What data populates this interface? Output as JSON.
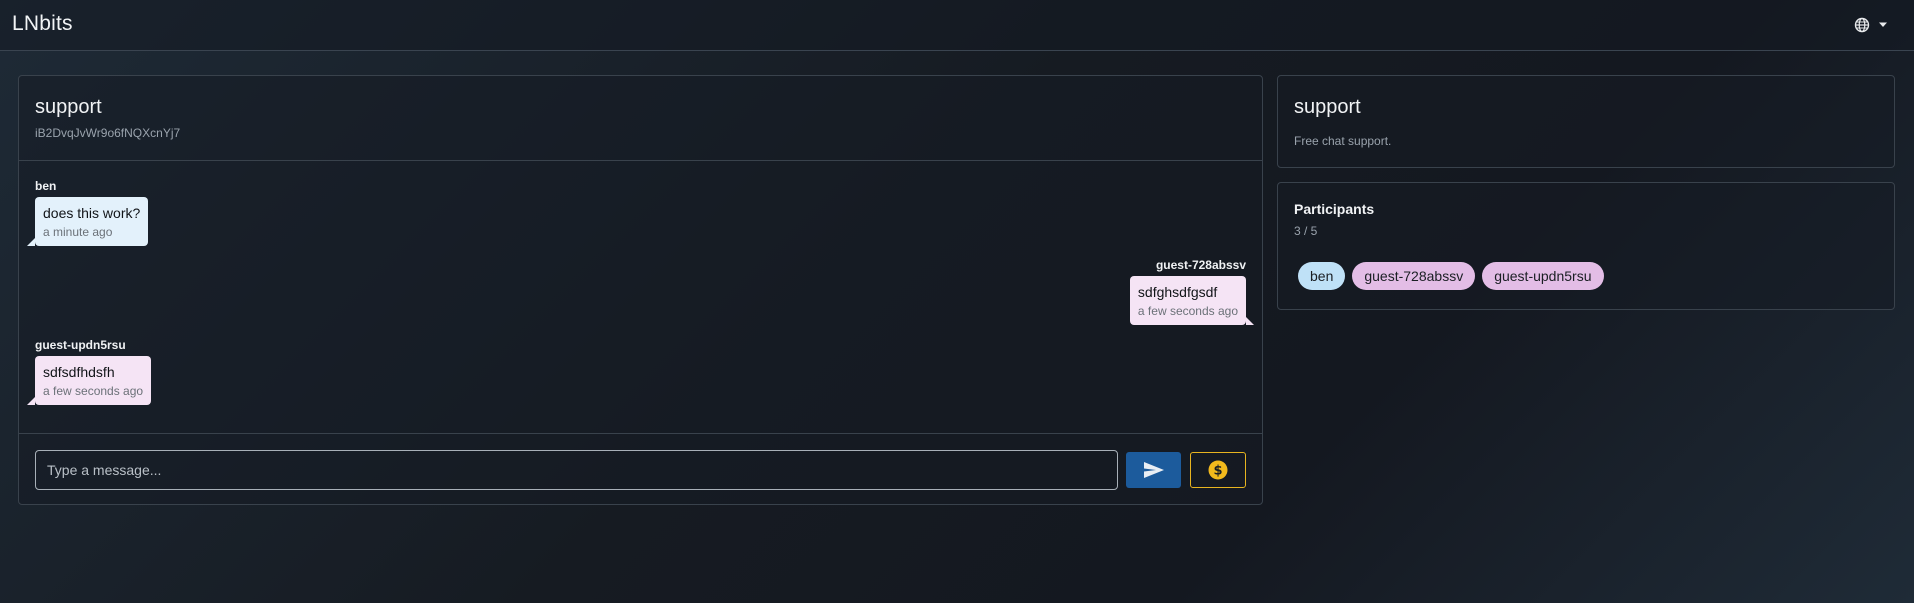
{
  "app": {
    "title": "LNbits",
    "language_icon": "globe-icon",
    "dropdown_icon": "caret-down-icon"
  },
  "chat": {
    "title": "support",
    "room_id": "iB2DvqJvWr9o6fNQXcnYj7",
    "messages": [
      {
        "name": "ben",
        "text": "does this work?",
        "time": "a minute ago",
        "side": "left",
        "color": "#e3f1fb"
      },
      {
        "name": "guest-728abssv",
        "text": "sdfghsdfgsdf",
        "time": "a few seconds ago",
        "side": "right",
        "color": "#f5e4f5"
      },
      {
        "name": "guest-updn5rsu",
        "text": "sdfsdfhdsfh",
        "time": "a few seconds ago",
        "side": "left",
        "color": "#f5e4f5"
      }
    ],
    "input_placeholder": "Type a message...",
    "send_icon": "send-icon",
    "tip_icon": "dollar-coin-icon"
  },
  "info": {
    "title": "support",
    "description": "Free chat support."
  },
  "participants": {
    "title": "Participants",
    "count": "3 / 5",
    "chips": [
      {
        "label": "ben",
        "color": "#bfe1f7"
      },
      {
        "label": "guest-728abssv",
        "color": "#e3bde6"
      },
      {
        "label": "guest-updn5rsu",
        "color": "#e3bde6"
      }
    ]
  },
  "colors": {
    "primary": "#1c5b9c",
    "accent": "#e7b420",
    "border": "#39424c"
  }
}
